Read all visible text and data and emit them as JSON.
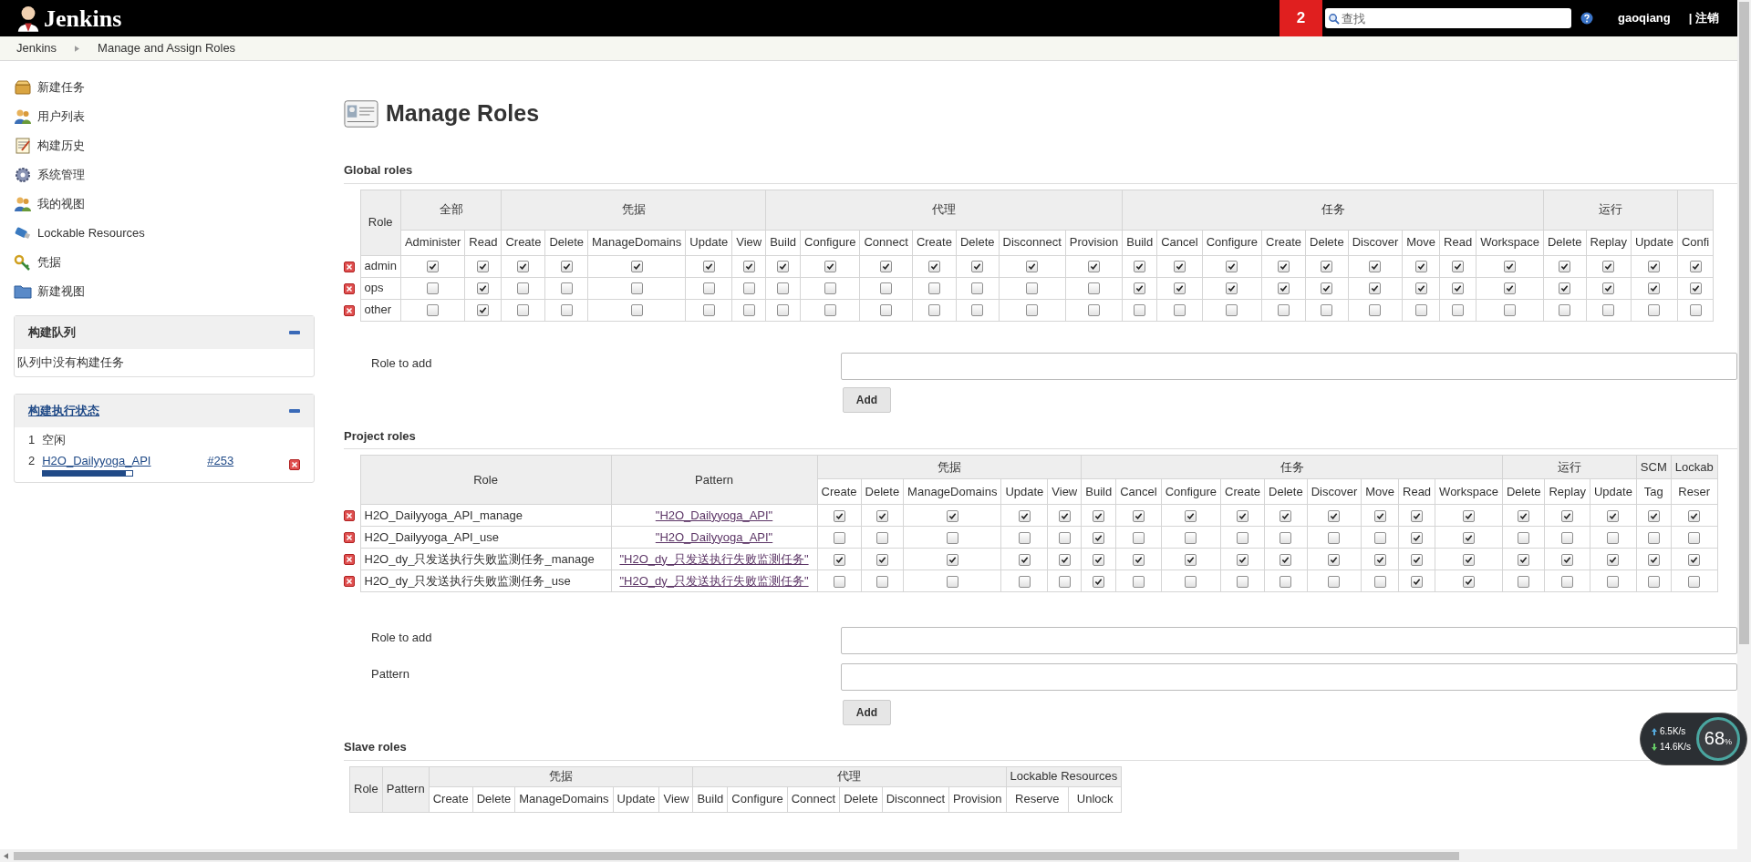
{
  "header": {
    "brand": "Jenkins",
    "notification_count": "2",
    "search": {
      "placeholder": "查找"
    },
    "user": "gaoqiang",
    "logout": "| 注销"
  },
  "breadcrumb": [
    "Jenkins",
    "Manage and Assign Roles"
  ],
  "sidebar": {
    "items": [
      {
        "label": "新建任务",
        "kind": "package"
      },
      {
        "label": "用户列表",
        "kind": "people"
      },
      {
        "label": "构建历史",
        "kind": "notepad"
      },
      {
        "label": "系统管理",
        "kind": "gear"
      },
      {
        "label": "我的视图",
        "kind": "people"
      },
      {
        "label": "Lockable Resources",
        "kind": "usb"
      },
      {
        "label": "凭据",
        "kind": "key"
      },
      {
        "label": "新建视图",
        "kind": "folder"
      }
    ],
    "build_queue": {
      "title": "构建队列",
      "message": "队列中没有构建任务"
    },
    "executors": {
      "title": "构建执行状态",
      "rows": [
        {
          "number": "1",
          "status": "空闲"
        },
        {
          "number": "2",
          "job": "H2O_Dailyyoga_API",
          "build": "#253",
          "level": 0.93
        }
      ]
    }
  },
  "page_title": "Manage Roles",
  "global_roles": {
    "title": "Global roles",
    "role_header": "Role",
    "groups": [
      {
        "label": "全部",
        "columns": [
          "Administer",
          "Read"
        ]
      },
      {
        "label": "凭据",
        "columns": [
          "Create",
          "Delete",
          "ManageDomains",
          "Update",
          "View"
        ]
      },
      {
        "label": "代理",
        "columns": [
          "Build",
          "Configure",
          "Connect",
          "Create",
          "Delete",
          "Disconnect",
          "Provision"
        ]
      },
      {
        "label": "任务",
        "columns": [
          "Build",
          "Cancel",
          "Configure",
          "Create",
          "Delete",
          "Discover",
          "Move",
          "Read",
          "Workspace"
        ]
      },
      {
        "label": "运行",
        "columns": [
          "Delete",
          "Replay",
          "Update"
        ]
      },
      {
        "columns": [
          "Confi"
        ]
      }
    ],
    "rows": [
      {
        "role": "admin",
        "checks": [
          {
            "checked": true
          },
          {
            "checked": true
          },
          {
            "checked": true
          },
          {
            "checked": true
          },
          {
            "checked": true
          },
          {
            "checked": true
          },
          {
            "checked": true
          },
          {
            "checked": true
          },
          {
            "checked": true
          },
          {
            "checked": true
          },
          {
            "checked": true
          },
          {
            "checked": true
          },
          {
            "checked": true
          },
          {
            "checked": true
          },
          {
            "checked": true
          },
          {
            "checked": true
          },
          {
            "checked": true
          },
          {
            "checked": true
          },
          {
            "checked": true
          },
          {
            "checked": true
          },
          {
            "checked": true
          },
          {
            "checked": true
          },
          {
            "checked": true
          },
          {
            "checked": true
          },
          {
            "checked": true
          },
          {
            "checked": true
          },
          {
            "checked": true
          }
        ]
      },
      {
        "role": "ops",
        "checks": [
          {
            "checked": false
          },
          {
            "checked": true
          },
          {
            "checked": false
          },
          {
            "checked": false
          },
          {
            "checked": false
          },
          {
            "checked": false
          },
          {
            "checked": false
          },
          {
            "checked": false
          },
          {
            "checked": false
          },
          {
            "checked": false
          },
          {
            "checked": false
          },
          {
            "checked": false
          },
          {
            "checked": false
          },
          {
            "checked": false
          },
          {
            "checked": true
          },
          {
            "checked": true
          },
          {
            "checked": true
          },
          {
            "checked": true
          },
          {
            "checked": true
          },
          {
            "checked": true
          },
          {
            "checked": true
          },
          {
            "checked": true
          },
          {
            "checked": true
          },
          {
            "checked": true
          },
          {
            "checked": true
          },
          {
            "checked": true
          },
          {
            "checked": true
          }
        ]
      },
      {
        "role": "other",
        "checks": [
          {
            "checked": false
          },
          {
            "checked": true
          },
          {
            "checked": false
          },
          {
            "checked": false
          },
          {
            "checked": false
          },
          {
            "checked": false
          },
          {
            "checked": false
          },
          {
            "checked": false
          },
          {
            "checked": false
          },
          {
            "checked": false
          },
          {
            "checked": false
          },
          {
            "checked": false
          },
          {
            "checked": false
          },
          {
            "checked": false
          },
          {
            "checked": false
          },
          {
            "checked": false
          },
          {
            "checked": false
          },
          {
            "checked": false
          },
          {
            "checked": false
          },
          {
            "checked": false
          },
          {
            "checked": false
          },
          {
            "checked": false
          },
          {
            "checked": false
          },
          {
            "checked": false
          },
          {
            "checked": false
          },
          {
            "checked": false
          },
          {
            "checked": false
          }
        ]
      }
    ],
    "form": {
      "role_label": "Role to add",
      "button": "Add"
    }
  },
  "project_roles": {
    "title": "Project roles",
    "role_header": "Role",
    "pattern_header": "Pattern",
    "groups": [
      {
        "label": "凭据",
        "columns": [
          "Create",
          "Delete",
          "ManageDomains",
          "Update",
          "View"
        ]
      },
      {
        "label": "任务",
        "columns": [
          "Build",
          "Cancel",
          "Configure",
          "Create",
          "Delete",
          "Discover",
          "Move",
          "Read",
          "Workspace"
        ]
      },
      {
        "label": "运行",
        "columns": [
          "Delete",
          "Replay",
          "Update"
        ]
      },
      {
        "label": "SCM",
        "columns": [
          "Tag"
        ]
      },
      {
        "label": "Lockab",
        "columns": [
          "Reser"
        ]
      }
    ],
    "rows": [
      {
        "role": "H2O_Dailyyoga_API_manage",
        "pattern": "\"H2O_Dailyyoga_API\"",
        "checks": [
          {
            "checked": true
          },
          {
            "checked": true
          },
          {
            "checked": true
          },
          {
            "checked": true
          },
          {
            "checked": true
          },
          {
            "checked": true
          },
          {
            "checked": true
          },
          {
            "checked": true
          },
          {
            "checked": true
          },
          {
            "checked": true
          },
          {
            "checked": true
          },
          {
            "checked": true
          },
          {
            "checked": true
          },
          {
            "checked": true
          },
          {
            "checked": true
          },
          {
            "checked": true
          },
          {
            "checked": true
          },
          {
            "checked": true
          },
          {
            "checked": true
          }
        ]
      },
      {
        "role": "H2O_Dailyyoga_API_use",
        "pattern": "\"H2O_Dailyyoga_API\"",
        "checks": [
          {
            "checked": false
          },
          {
            "checked": false
          },
          {
            "checked": false
          },
          {
            "checked": false
          },
          {
            "checked": false
          },
          {
            "checked": true
          },
          {
            "checked": false
          },
          {
            "checked": false
          },
          {
            "checked": false
          },
          {
            "checked": false
          },
          {
            "checked": false
          },
          {
            "checked": false
          },
          {
            "checked": true
          },
          {
            "checked": true
          },
          {
            "checked": false
          },
          {
            "checked": false
          },
          {
            "checked": false
          },
          {
            "checked": false
          },
          {
            "checked": false
          }
        ]
      },
      {
        "role": "H2O_dy_只发送执行失败监测任务_manage",
        "pattern": "\"H2O_dy_只发送执行失败监测任务\"",
        "checks": [
          {
            "checked": true
          },
          {
            "checked": true
          },
          {
            "checked": true
          },
          {
            "checked": true
          },
          {
            "checked": true
          },
          {
            "checked": true
          },
          {
            "checked": true
          },
          {
            "checked": true
          },
          {
            "checked": true
          },
          {
            "checked": true
          },
          {
            "checked": true
          },
          {
            "checked": true
          },
          {
            "checked": true
          },
          {
            "checked": true
          },
          {
            "checked": true
          },
          {
            "checked": true
          },
          {
            "checked": true
          },
          {
            "checked": true
          },
          {
            "checked": true
          }
        ]
      },
      {
        "role": "H2O_dy_只发送执行失败监测任务_use",
        "pattern": "\"H2O_dy_只发送执行失败监测任务\"",
        "checks": [
          {
            "checked": false
          },
          {
            "checked": false
          },
          {
            "checked": false
          },
          {
            "checked": false
          },
          {
            "checked": false
          },
          {
            "checked": true
          },
          {
            "checked": false
          },
          {
            "checked": false
          },
          {
            "checked": false
          },
          {
            "checked": false
          },
          {
            "checked": false
          },
          {
            "checked": false
          },
          {
            "checked": true
          },
          {
            "checked": true
          },
          {
            "checked": false
          },
          {
            "checked": false
          },
          {
            "checked": false
          },
          {
            "checked": false
          },
          {
            "checked": false
          }
        ]
      }
    ],
    "form": {
      "role_label": "Role to add",
      "pattern_label": "Pattern",
      "button": "Add"
    }
  },
  "slave_roles": {
    "title": "Slave roles",
    "role_header": "Role",
    "pattern_header": "Pattern",
    "groups": [
      {
        "label": "凭据",
        "columns": [
          "Create",
          "Delete",
          "ManageDomains",
          "Update",
          "View"
        ]
      },
      {
        "label": "代理",
        "columns": [
          "Build",
          "Configure",
          "Connect",
          "Delete",
          "Disconnect",
          "Provision"
        ]
      },
      {
        "label": "Lockable Resources",
        "columns": [
          "Reserve",
          "Unlock"
        ]
      }
    ]
  },
  "network_widget": {
    "upload": "6.5K/s",
    "download": "14.6K/s",
    "percent": "68",
    "unit": "%"
  }
}
